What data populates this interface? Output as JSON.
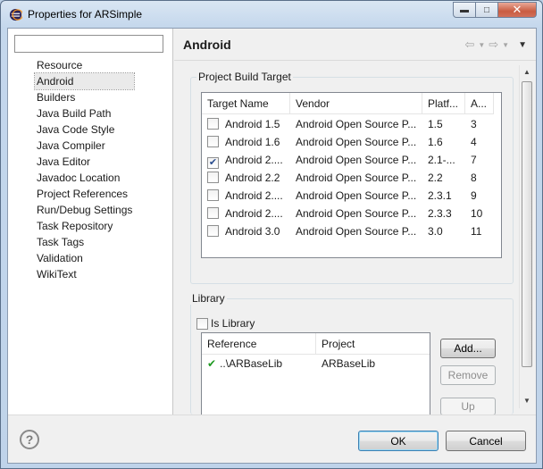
{
  "window": {
    "title": "Properties for ARSimple",
    "minimize_icon": "minimize-icon",
    "maximize_icon": "maximize-icon",
    "close_icon": "close-icon"
  },
  "left_panel": {
    "filter": {
      "value": "",
      "placeholder": ""
    },
    "items": [
      {
        "label": "Resource",
        "selected": false
      },
      {
        "label": "Android",
        "selected": true
      },
      {
        "label": "Builders",
        "selected": false
      },
      {
        "label": "Java Build Path",
        "selected": false
      },
      {
        "label": "Java Code Style",
        "selected": false
      },
      {
        "label": "Java Compiler",
        "selected": false
      },
      {
        "label": "Java Editor",
        "selected": false
      },
      {
        "label": "Javadoc Location",
        "selected": false
      },
      {
        "label": "Project References",
        "selected": false
      },
      {
        "label": "Run/Debug Settings",
        "selected": false
      },
      {
        "label": "Task Repository",
        "selected": false
      },
      {
        "label": "Task Tags",
        "selected": false
      },
      {
        "label": "Validation",
        "selected": false
      },
      {
        "label": "WikiText",
        "selected": false
      }
    ]
  },
  "page": {
    "title": "Android",
    "back_icon": "back-arrow-icon",
    "forward_icon": "forward-arrow-icon",
    "menu_icon": "view-menu-icon"
  },
  "build_target": {
    "legend": "Project Build Target",
    "columns": [
      "Target Name",
      "Vendor",
      "Platf...",
      "A..."
    ],
    "rows": [
      {
        "checked": false,
        "name": "Android 1.5",
        "vendor": "Android Open Source P...",
        "platform": "1.5",
        "api": "3"
      },
      {
        "checked": false,
        "name": "Android 1.6",
        "vendor": "Android Open Source P...",
        "platform": "1.6",
        "api": "4"
      },
      {
        "checked": true,
        "name": "Android 2....",
        "vendor": "Android Open Source P...",
        "platform": "2.1-...",
        "api": "7"
      },
      {
        "checked": false,
        "name": "Android 2.2",
        "vendor": "Android Open Source P...",
        "platform": "2.2",
        "api": "8"
      },
      {
        "checked": false,
        "name": "Android 2....",
        "vendor": "Android Open Source P...",
        "platform": "2.3.1",
        "api": "9"
      },
      {
        "checked": false,
        "name": "Android 2....",
        "vendor": "Android Open Source P...",
        "platform": "2.3.3",
        "api": "10"
      },
      {
        "checked": false,
        "name": "Android 3.0",
        "vendor": "Android Open Source P...",
        "platform": "3.0",
        "api": "11"
      }
    ]
  },
  "library": {
    "legend": "Library",
    "is_library_label": "Is Library",
    "is_library_checked": false,
    "columns": [
      "Reference",
      "Project"
    ],
    "rows": [
      {
        "reference": "..\\ARBaseLib",
        "project": "ARBaseLib",
        "status_icon": "check-icon"
      }
    ],
    "buttons": {
      "add": "Add...",
      "remove": "Remove",
      "up": "Up"
    }
  },
  "footer": {
    "help_icon": "help-icon",
    "ok": "OK",
    "cancel": "Cancel"
  },
  "colors": {
    "title_bar": "#c4d7ec",
    "close_button": "#c95c41",
    "check_ok": "#1f9a22"
  }
}
